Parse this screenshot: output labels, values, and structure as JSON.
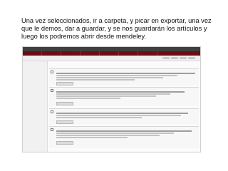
{
  "caption": "Una vez seleccionados, ir a carpeta, y picar en exportar, una vez que le demos, dar a guardar, y se nos guardarán los artículos y luego los podremos abrir desde mendeley.",
  "colors": {
    "navbar": "#6e0d14",
    "topbar": "#3f3f3f",
    "link": "#7b1018"
  },
  "screenshot": {
    "nav_items": [
      "",
      "",
      "",
      "",
      "",
      "",
      ""
    ],
    "breadcrumb": "",
    "sidebar_items": [
      "",
      "",
      "",
      "",
      "",
      "",
      "",
      "",
      "",
      "",
      "",
      "",
      "",
      "",
      ""
    ],
    "main_heading": "",
    "articles": [
      {
        "title": ""
      },
      {
        "title": ""
      },
      {
        "title": ""
      },
      {
        "title": ""
      }
    ]
  }
}
